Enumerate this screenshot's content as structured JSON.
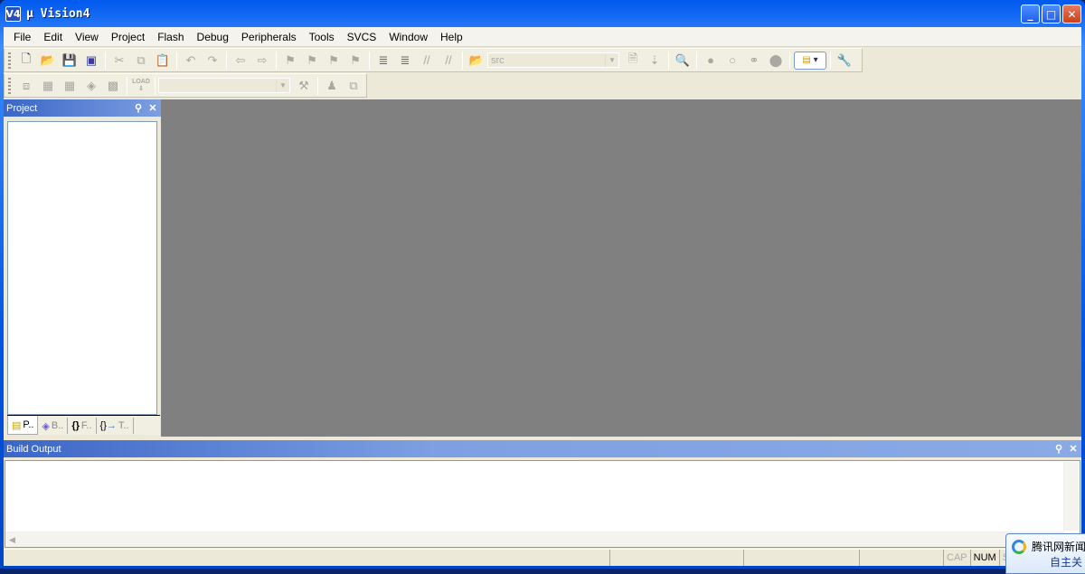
{
  "window": {
    "title": "µ Vision4",
    "icon_text": "V4",
    "controls": [
      "minimize",
      "maximize",
      "close"
    ]
  },
  "menu": [
    "File",
    "Edit",
    "View",
    "Project",
    "Flash",
    "Debug",
    "Peripherals",
    "Tools",
    "SVCS",
    "Window",
    "Help"
  ],
  "toolbar1": {
    "find_combo_value": "src"
  },
  "toolbar2": {
    "target_combo_value": "",
    "load_label": "LOAD"
  },
  "project_panel": {
    "title": "Project",
    "tabs": [
      "P..",
      "B..",
      "F..",
      "T.."
    ]
  },
  "build_output": {
    "title": "Build Output"
  },
  "status": {
    "cap": "CAP",
    "num": "NUM",
    "scrl": "SC"
  },
  "notification": {
    "title": "腾讯网新闻",
    "line2": "自主关"
  },
  "colors": {
    "titlebar": "#0055e5",
    "mdi_background": "#808080",
    "panel_header": "#3b66c8",
    "chrome": "#ece9d8"
  }
}
